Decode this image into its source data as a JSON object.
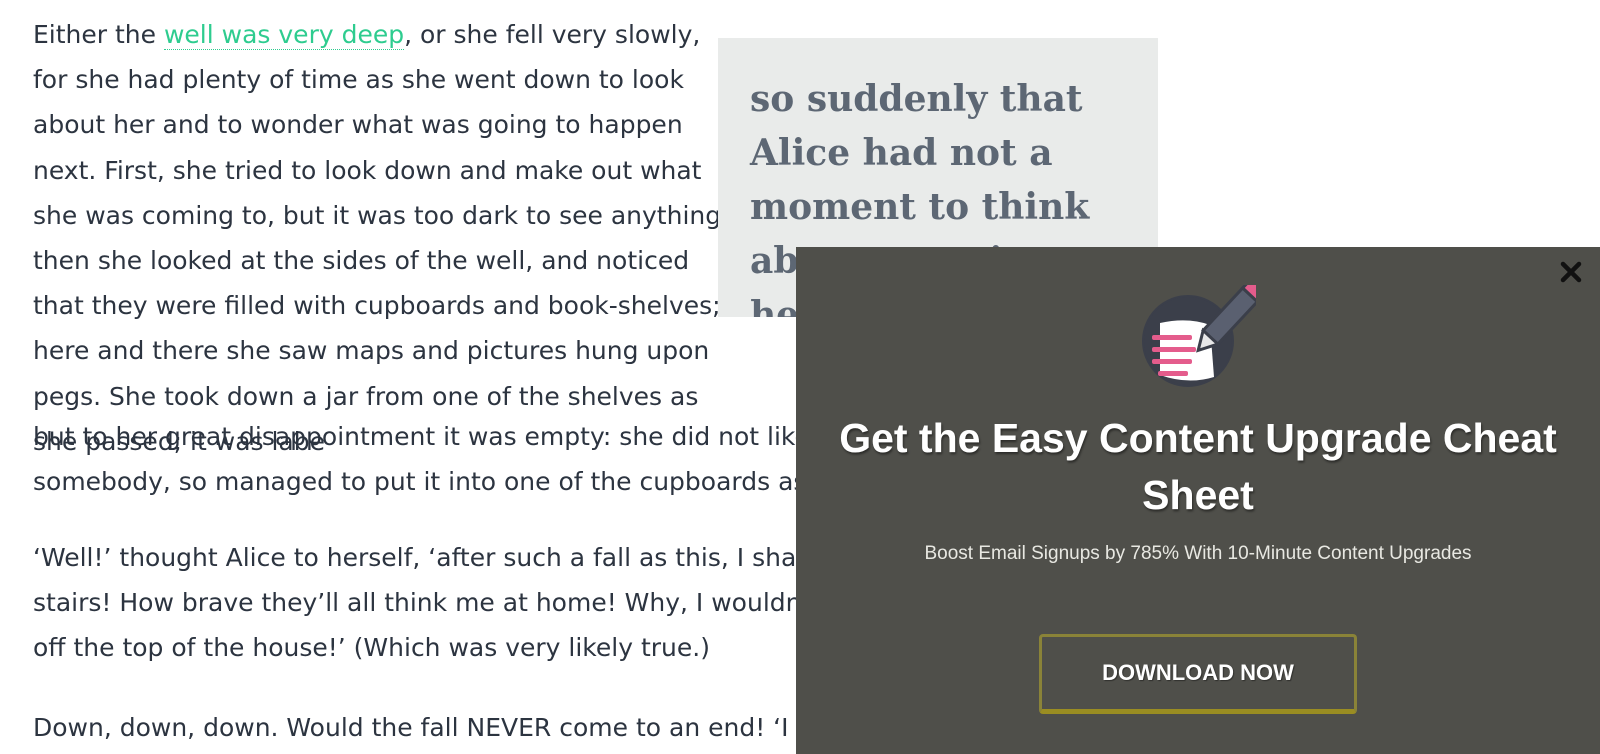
{
  "article": {
    "paragraphs": [
      {
        "before_link": "Either the ",
        "link": "well was very deep",
        "after_link": ", or she fell very slowly, for she had plenty of time as she went down to look about her and to wonder what was going to happen next. First, she tried to look down and make out what she was coming to, but it was too dark to see anything; then she looked at the sides of the well, and noticed that they were filled with cupboards and book-shelves; here and there she saw maps and pictures hung upon pegs. She took down a jar from one of the shelves as she passed; it was labe",
        "line_tail": "but to her great disappointment it was empty: she did not like to d",
        "line_tail2": "somebody, so managed to put it into one of the cupboards as she"
      },
      {
        "text_line1": "‘Well!’ thought Alice to herself, ‘after such a fall as this, I shall thin",
        "text_line2": "stairs! How brave they’ll all think me at home! Why, I wouldn’t say",
        "text_line3": "off the top of the house!’ (Which was very likely true.)"
      },
      {
        "text_line1": "Down, down, down. Would the fall NEVER come to an end! ‘I wond"
      }
    ]
  },
  "pullquote": {
    "text": "so suddenly that Alice had not a moment to think about stopping herself"
  },
  "popup": {
    "icon": "notepad-pencil-icon",
    "close_icon": "close-icon",
    "headline": "Get the Easy Content Upgrade Cheat Sheet",
    "subline": "Boost Email Signups by 785% With 10-Minute Content Upgrades",
    "cta_label": "DOWNLOAD NOW",
    "colors": {
      "overlay_bg": "#4f4f4a",
      "cta_border": "#9a8d22",
      "badge_bg": "#3b3f4a",
      "pencil_tip": "#e45c8c"
    }
  }
}
